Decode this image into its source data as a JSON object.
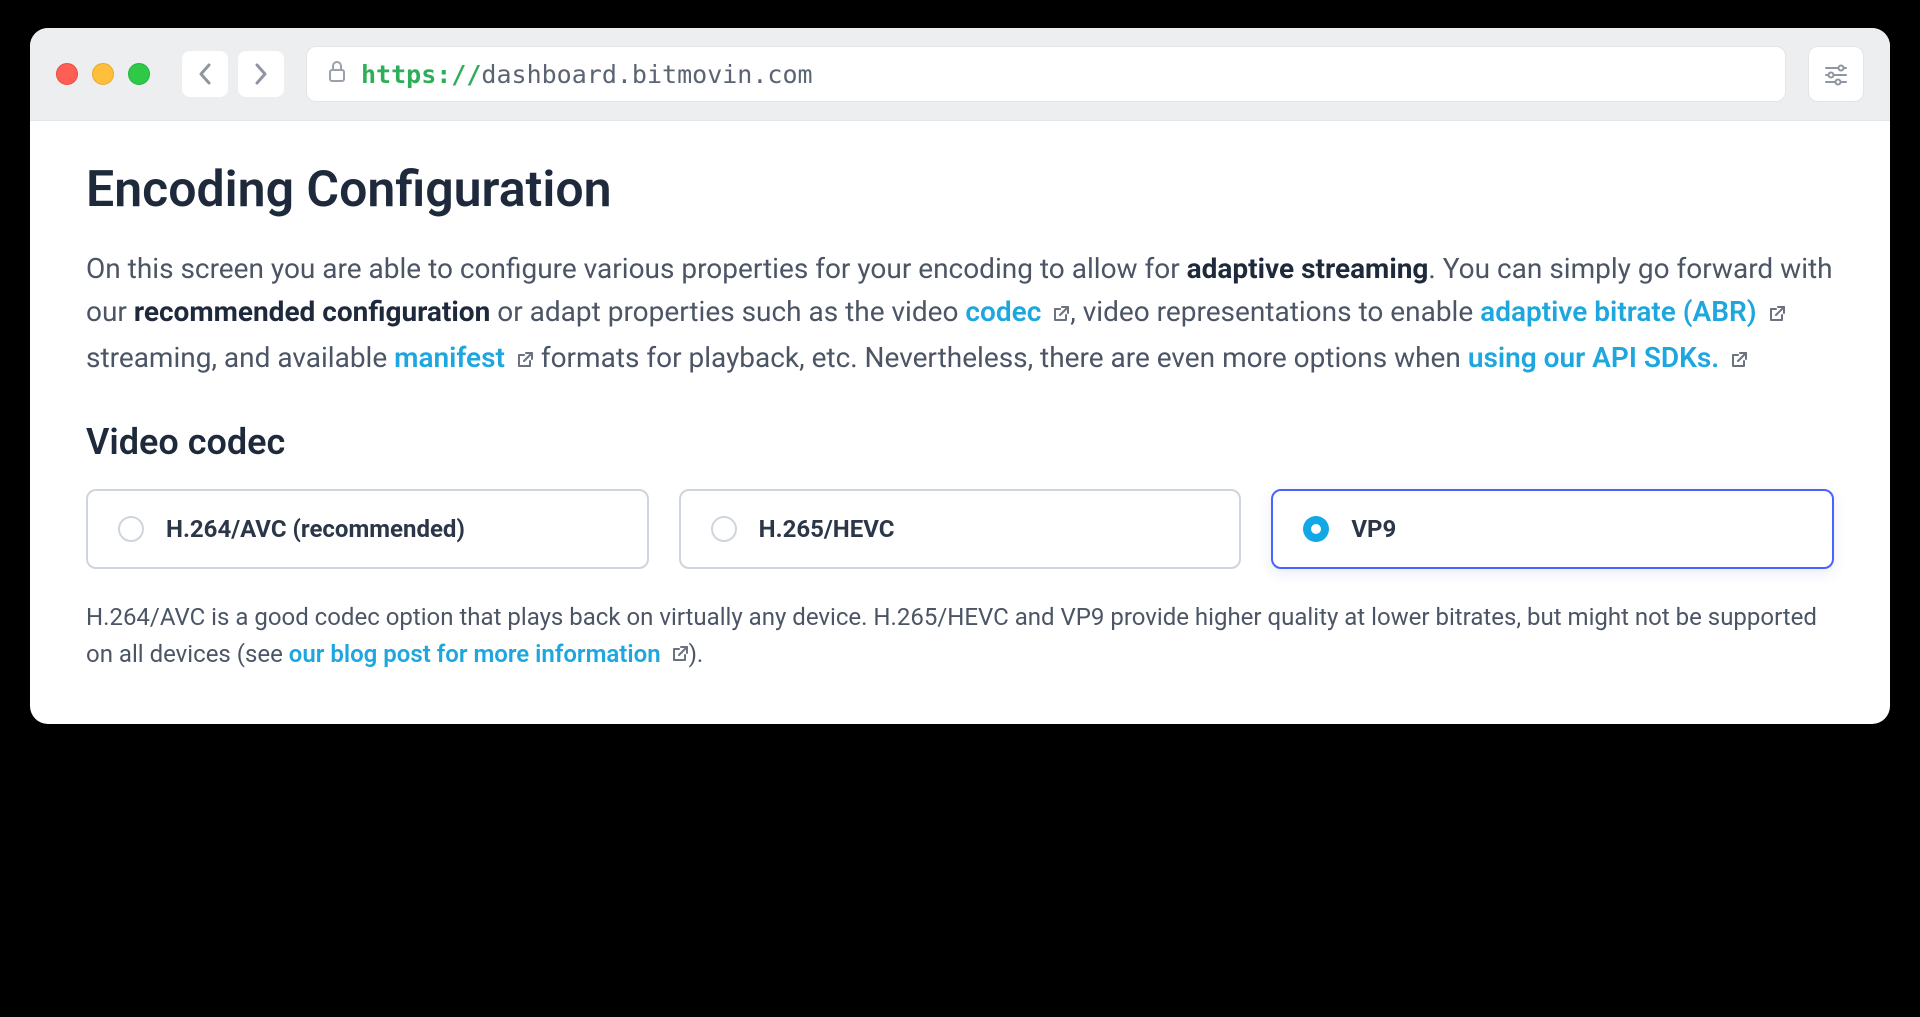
{
  "browser": {
    "url_protocol": "https://",
    "url_host": "dashboard.bitmovin.com"
  },
  "page": {
    "title": "Encoding Configuration",
    "desc_parts": {
      "a": "On this screen you are able to configure various properties for your encoding to allow for ",
      "bold1": "adaptive streaming",
      "b": ". You can simply go forward with our ",
      "bold2": "recommended configuration",
      "c": " or adapt properties such as the video ",
      "link1": "codec",
      "d": ", video representations to enable ",
      "link2": "adaptive bitrate (ABR)",
      "e": " streaming, and available ",
      "link3": "manifest",
      "f": " formats for playback, etc. Nevertheless, there are even more options when ",
      "link4": "using our API SDKs.",
      "g": ""
    },
    "codec_heading": "Video codec",
    "codec_options": {
      "opt0": "H.264/AVC (recommended)",
      "opt1": "H.265/HEVC",
      "opt2": "VP9"
    },
    "note_parts": {
      "a": "H.264/AVC is a good codec option that plays back on virtually any device. H.265/HEVC and VP9 provide higher quality at lower bitrates, but might not be supported on all devices (see ",
      "link": "our blog post for more information",
      "b": ")."
    }
  }
}
